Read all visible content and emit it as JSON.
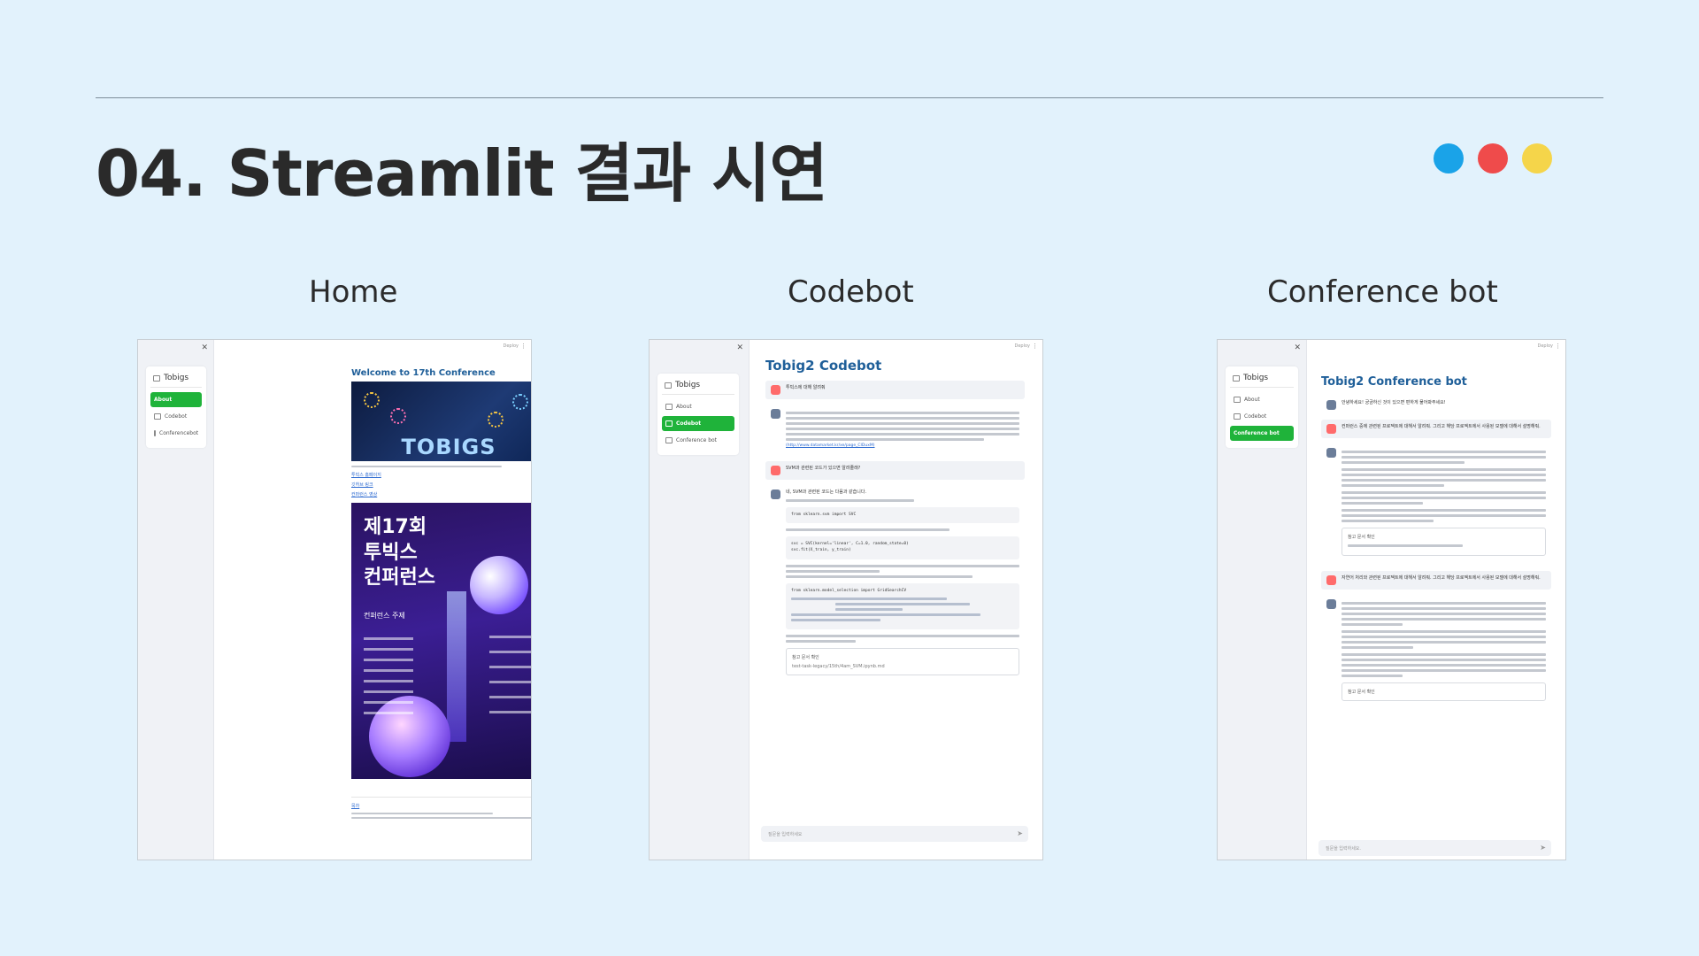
{
  "slide": {
    "title": "04. Streamlit 결과 시연",
    "dot_colors": [
      "#1aa3e8",
      "#ef4b4b",
      "#f5d54a"
    ]
  },
  "panels": {
    "home": {
      "label": "Home",
      "sidebar_title": "Tobigs",
      "nav": [
        "About",
        "Codebot",
        "Conferencebot"
      ],
      "active": "About",
      "deploy": "Deploy",
      "main_title": "Welcome to 17th Conference",
      "banner_text": "TOBIGS",
      "poster_heading": "제17회\n투빅스\n컨퍼런스",
      "poster_subheading": "컨퍼런스 주제",
      "links": [
        "투빅스 홈페이지",
        "깃허브 링크",
        "컨퍼런스 영상"
      ],
      "footer_link": "목차"
    },
    "codebot": {
      "label": "Codebot",
      "sidebar_title": "Tobigs",
      "nav": [
        "About",
        "Codebot",
        "Conference bot"
      ],
      "active": "Codebot",
      "deploy": "Deploy",
      "main_title": "Tobig2 Codebot",
      "q1": "투빅스에 대해 알려줘",
      "link": "(http://www.datamarket.kr/xe/page_CIDuxM)",
      "q2": "SVM과 관련된 코드가 있으면 알려줄래?",
      "a2_head": "네, SVM과 관련된 코드는 다음과 같습니다.",
      "code1": "from sklearn.svm import SVC",
      "code2": "svc = SVC(kernel='linear', C=1.0, random_state=0)",
      "code3": "svc.fit(X_train, y_train)",
      "code4": "from sklearn.model_selection import GridSearchCV",
      "expander": "참고 문서 확인",
      "expander_path": "test-task-legacy/15th/4am_SVM.ipynb.md",
      "placeholder": "질문을 입력하세요"
    },
    "conference": {
      "label": "Conference bot",
      "sidebar_title": "Tobigs",
      "nav": [
        "About",
        "Codebot",
        "Conference bot"
      ],
      "active": "Conference bot",
      "deploy": "Deploy",
      "main_title": "Tobig2 Conference bot",
      "greeting": "안녕하세요! 궁금하신 것이 있으면 편하게 물어봐주세요!",
      "q1": "컨퍼런스 중에 관련된 프로젝트에 대해서 알려줘. 그리고 해당 프로젝트에서 사용된 모델에 대해서 설명해줘.",
      "expander1": "참고 문서 확인",
      "q2": "자연어 처리와 관련된 프로젝트에 대해서 알려줘. 그리고 해당 프로젝트에서 사용된 모델에 대해서 설명해줘.",
      "expander2": "참고 문서 확인",
      "placeholder": "질문을 입력하세요."
    }
  }
}
